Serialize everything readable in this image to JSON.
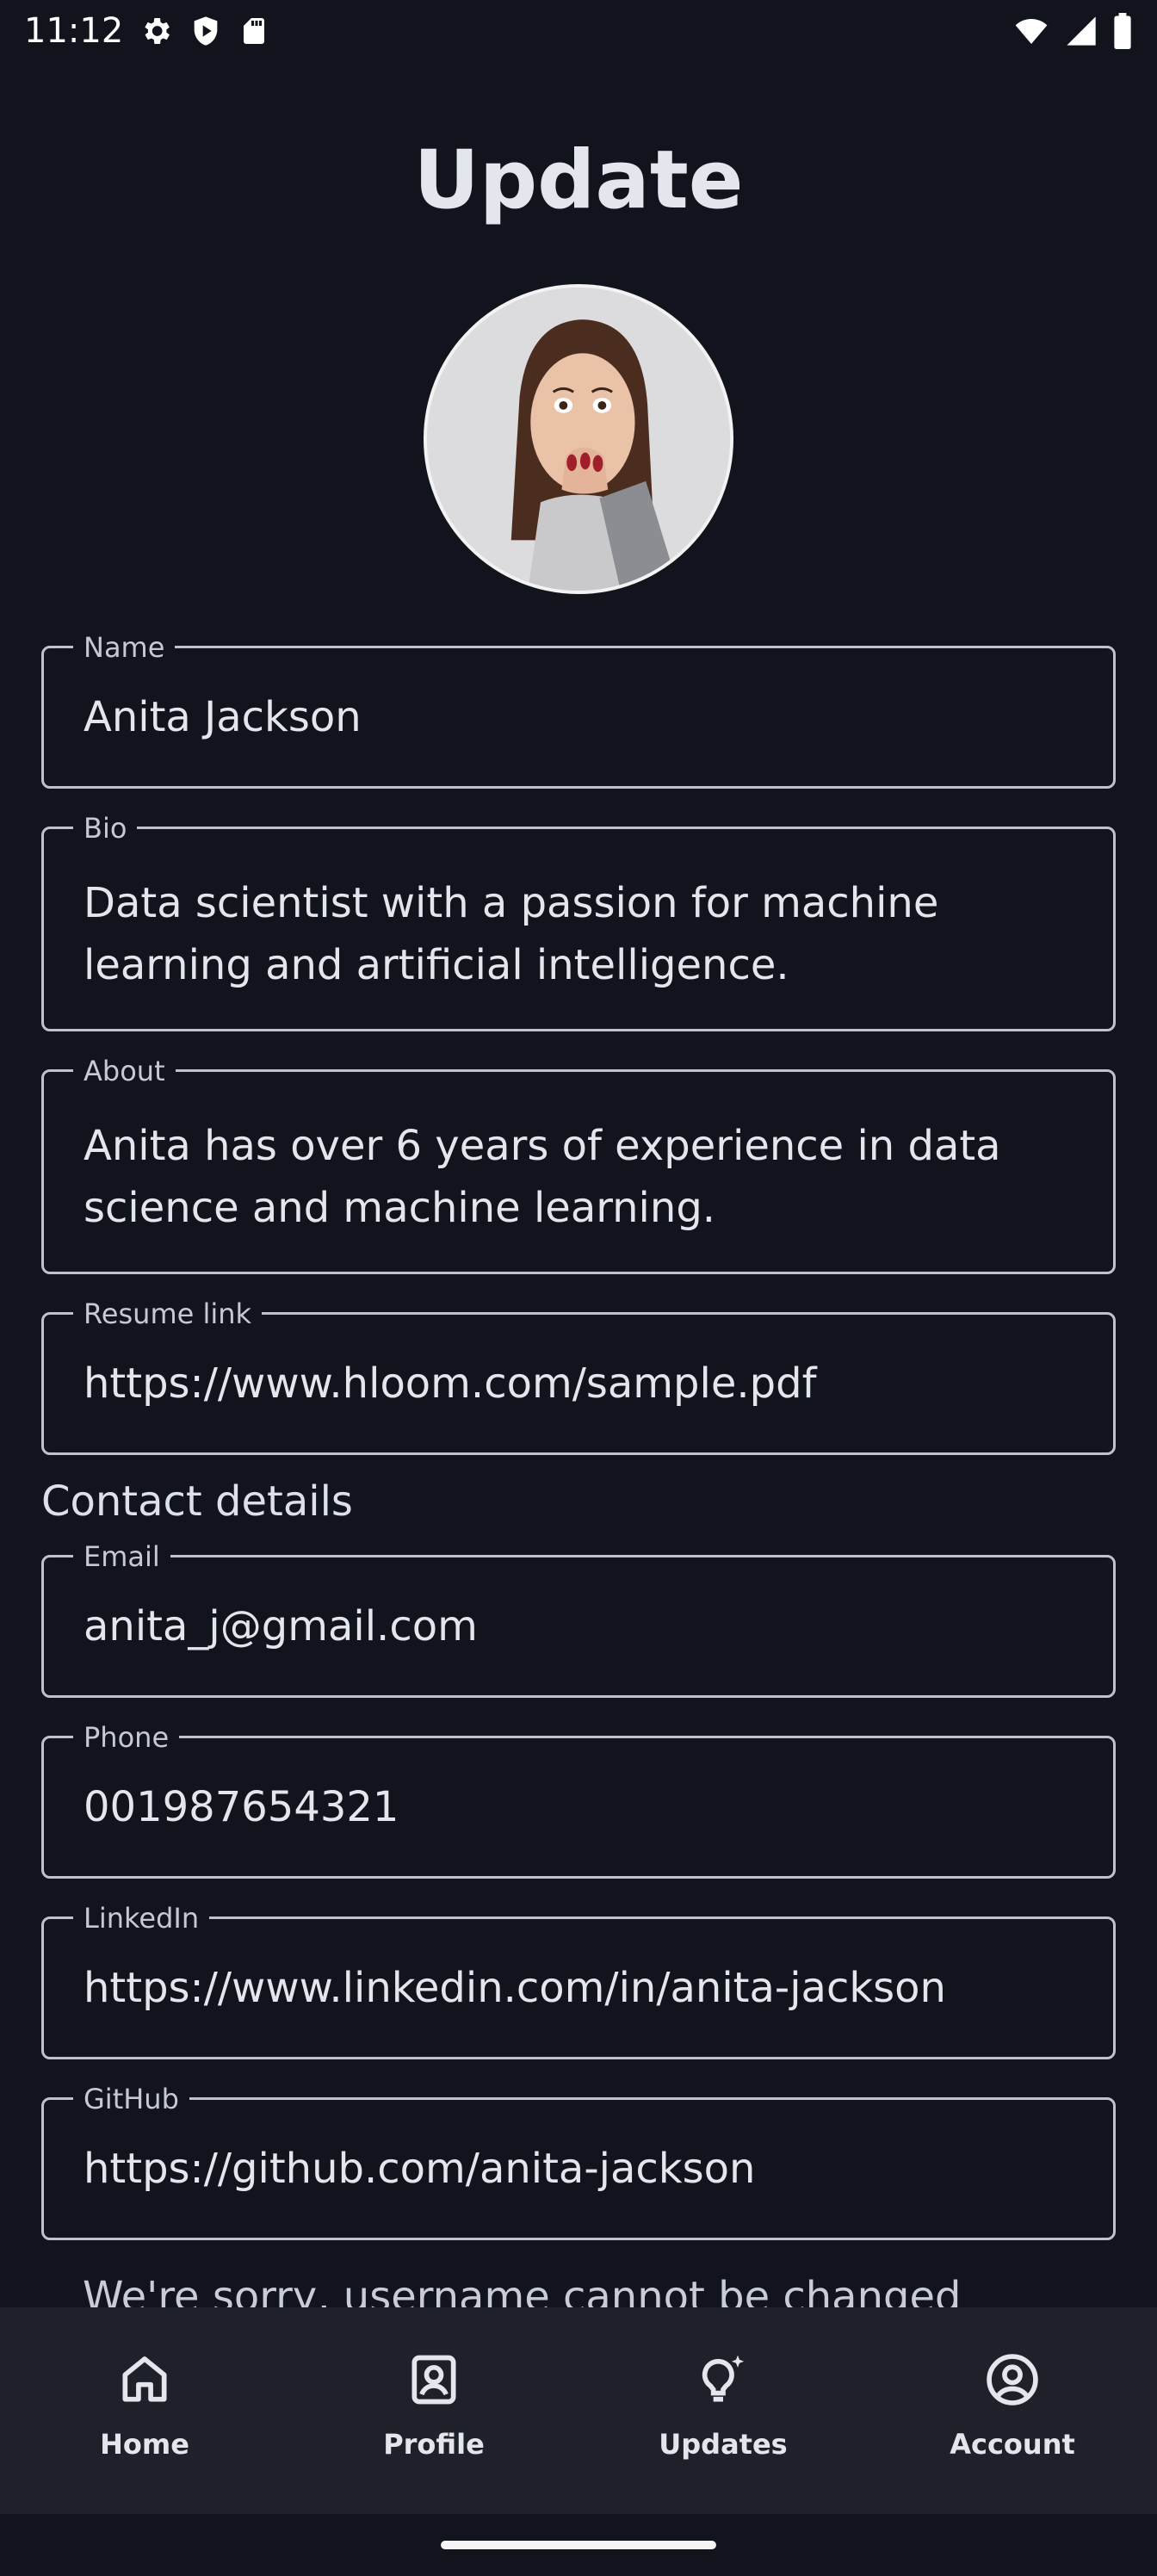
{
  "status_bar": {
    "time": "11:12",
    "icons": [
      "settings-icon",
      "shield-icon",
      "sd-card-icon",
      "wifi-icon",
      "signal-icon",
      "battery-icon"
    ]
  },
  "page": {
    "title": "Update"
  },
  "avatar": {
    "icon": "profile-photo"
  },
  "form": {
    "name": {
      "label": "Name",
      "value": "Anita Jackson"
    },
    "bio": {
      "label": "Bio",
      "value": "Data scientist with a passion for machine learning and artificial intelligence."
    },
    "about": {
      "label": "About",
      "value": "Anita has over 6 years of experience in data science and machine learning."
    },
    "resume": {
      "label": "Resume link",
      "value": "https://www.hloom.com/sample.pdf"
    }
  },
  "contact": {
    "heading": "Contact details",
    "email": {
      "label": "Email",
      "value": "anita_j@gmail.com"
    },
    "phone": {
      "label": "Phone",
      "value": "001987654321"
    },
    "linkedin": {
      "label": "LinkedIn",
      "value": "https://www.linkedin.com/in/anita-jackson"
    },
    "github": {
      "label": "GitHub",
      "value": "https://github.com/anita-jackson"
    }
  },
  "notice": "We're sorry, username cannot be changed",
  "bottom_nav": {
    "items": [
      {
        "label": "Home",
        "icon": "home-icon"
      },
      {
        "label": "Profile",
        "icon": "profile-icon"
      },
      {
        "label": "Updates",
        "icon": "updates-icon"
      },
      {
        "label": "Account",
        "icon": "account-icon"
      }
    ]
  },
  "colors": {
    "background": "#11141c",
    "nav_background": "#1e2129",
    "outline": "#bfc2cc",
    "text": "#e4e6ee"
  }
}
